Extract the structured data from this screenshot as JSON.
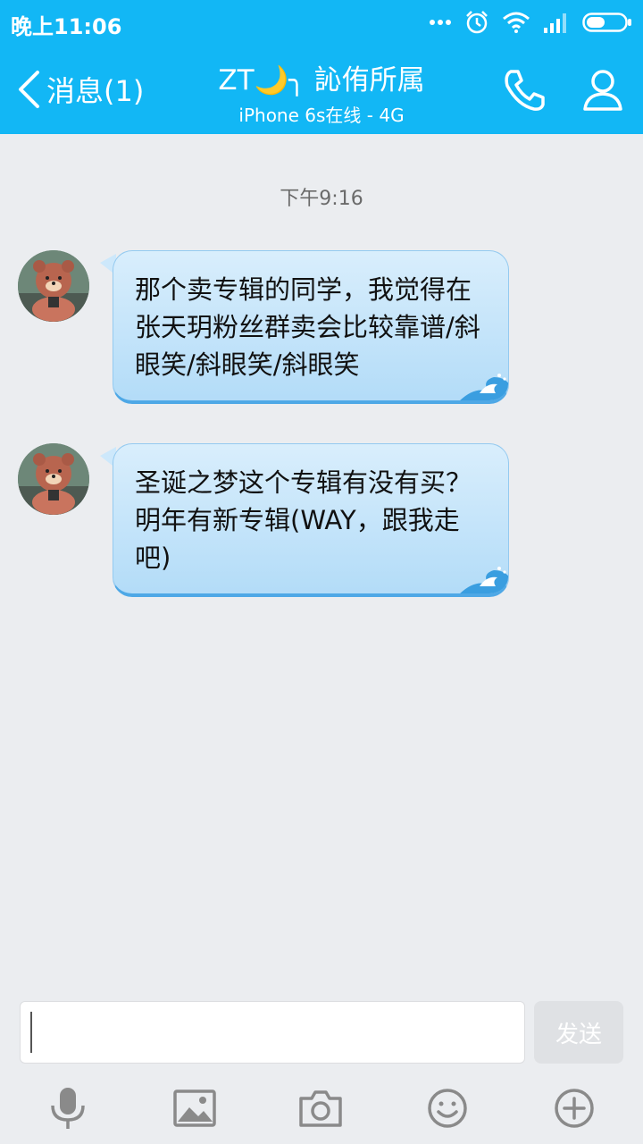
{
  "status_bar": {
    "time": "晚上11:06",
    "icons": [
      "more-dots-icon",
      "alarm-icon",
      "wifi-icon",
      "signal-icon",
      "battery-icon"
    ]
  },
  "nav": {
    "back_label": "消息(1)",
    "title": "ZT🌙╮ 訫侑所属",
    "subtitle": "iPhone 6s在线 - 4G",
    "icons": [
      "back-chevron-icon",
      "phone-icon",
      "profile-icon"
    ]
  },
  "chat": {
    "timestamp": "下午9:16",
    "messages": [
      {
        "text": "那个卖专辑的同学，我觉得在张天玥粉丝群卖会比较靠谱/斜眼笑/斜眼笑/斜眼笑"
      },
      {
        "text": "圣诞之梦这个专辑有没有买？明年有新专辑(WAY，跟我走吧)"
      }
    ]
  },
  "input": {
    "value": "",
    "placeholder": "",
    "send_label": "发送"
  },
  "toolbar": {
    "icons": [
      "microphone-icon",
      "image-icon",
      "camera-icon",
      "emoji-icon",
      "plus-icon"
    ]
  },
  "colors": {
    "header_bg": "#12b7f5",
    "chat_bg": "#ebedf0",
    "bubble_top": "#d9eefc",
    "bubble_bottom": "#b3dcf8",
    "bubble_border": "#4ea8e6",
    "send_disabled": "#dfe1e4"
  }
}
